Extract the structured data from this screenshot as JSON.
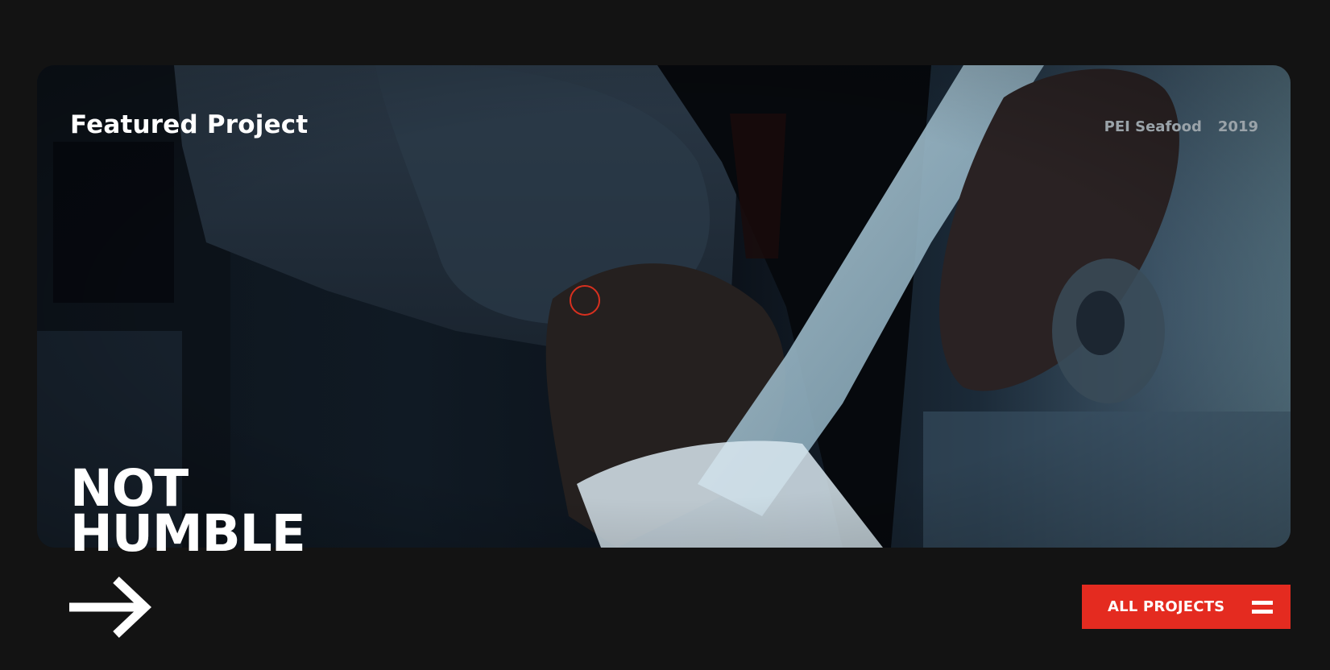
{
  "featured": {
    "title": "Featured Project",
    "client": "PEI Seafood",
    "year": "2019"
  },
  "project": {
    "name_line1": "NOT",
    "name_line2": "HUMBLE"
  },
  "nav": {
    "all_projects_label": "ALL PROJECTS"
  },
  "colors": {
    "background": "#131313",
    "accent": "#e42b20",
    "text": "#ffffff",
    "meta_text": "#9aa3a9"
  },
  "icons": {
    "arrow": "arrow-right-icon",
    "menu": "menu-icon",
    "cursor": "cursor-ring"
  }
}
